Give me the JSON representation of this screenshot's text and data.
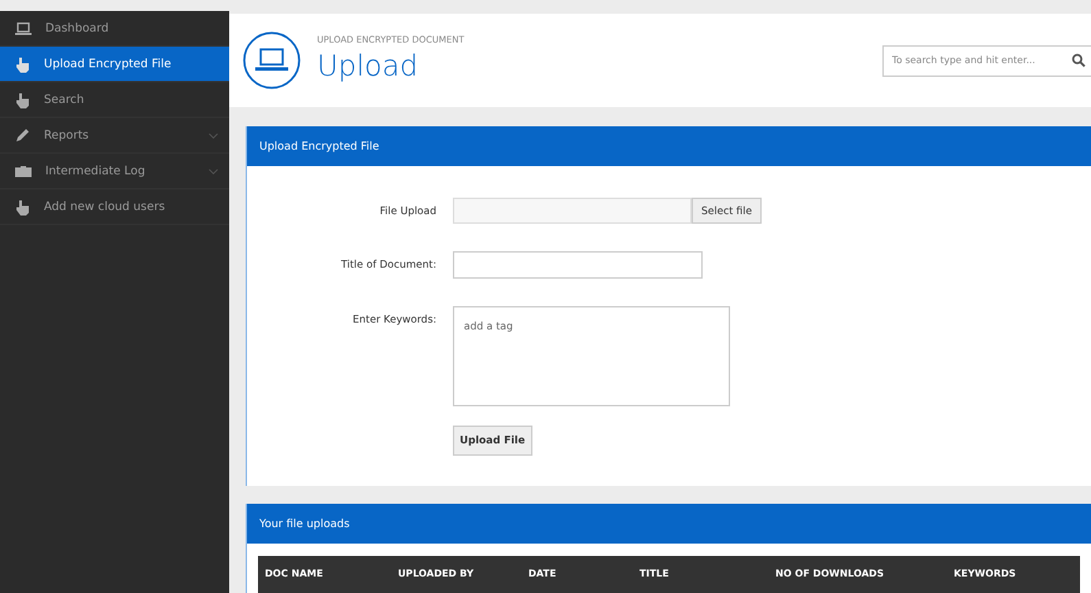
{
  "sidebar": {
    "items": [
      {
        "label": "Dashboard",
        "selected": false,
        "expandable": false
      },
      {
        "label": "Upload Encrypted File",
        "selected": true,
        "expandable": false
      },
      {
        "label": "Search",
        "selected": false,
        "expandable": false
      },
      {
        "label": "Reports",
        "selected": false,
        "expandable": true
      },
      {
        "label": "Intermediate Log",
        "selected": false,
        "expandable": true
      },
      {
        "label": "Add new cloud users",
        "selected": false,
        "expandable": false
      }
    ]
  },
  "header": {
    "subtitle": "UPLOAD ENCRYPTED DOCUMENT",
    "title": "Upload",
    "search": {
      "placeholder": "To search type and hit enter..."
    }
  },
  "upload_panel": {
    "title": "Upload Encrypted File",
    "file_label": "File Upload",
    "select_button": "Select file",
    "doc_title_label": "Title of Document:",
    "keywords_label": "Enter Keywords:",
    "keywords_placeholder": "add a tag",
    "submit_button": "Upload File"
  },
  "uploads_panel": {
    "title": "Your file uploads",
    "columns": [
      "DOC NAME",
      "UPLOADED BY",
      "DATE",
      "TITLE",
      "NO OF DOWNLOADS",
      "KEYWORDS"
    ]
  }
}
